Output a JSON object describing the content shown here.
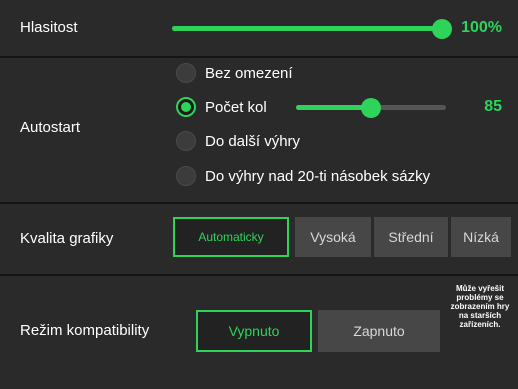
{
  "colors": {
    "accent": "#2ed35a",
    "panel": "#2a2a2a",
    "background": "#151515",
    "button": "#474747"
  },
  "volume": {
    "label": "Hlasitost",
    "value_text": "100%",
    "level": 1.0
  },
  "autostart": {
    "label": "Autostart",
    "options": [
      {
        "label": "Bez omezení",
        "checked": false
      },
      {
        "label": "Počet kol",
        "checked": true
      },
      {
        "label": "Do další výhry",
        "checked": false
      },
      {
        "label": "Do výhry nad 20-ti násobek sázky",
        "checked": false
      }
    ],
    "rounds_value_text": "85",
    "rounds_level": 0.5
  },
  "quality": {
    "label": "Kvalita grafiky",
    "options": [
      "Automaticky",
      "Vysoká",
      "Střední",
      "Nízká"
    ],
    "selected": "Automaticky"
  },
  "compatibility": {
    "label": "Režim kompatibility",
    "off_label": "Vypnuto",
    "on_label": "Zapnuto",
    "selected": "Vypnuto",
    "note": "Může vyřešit problémy se zobrazením hry na starších zařízeních."
  }
}
